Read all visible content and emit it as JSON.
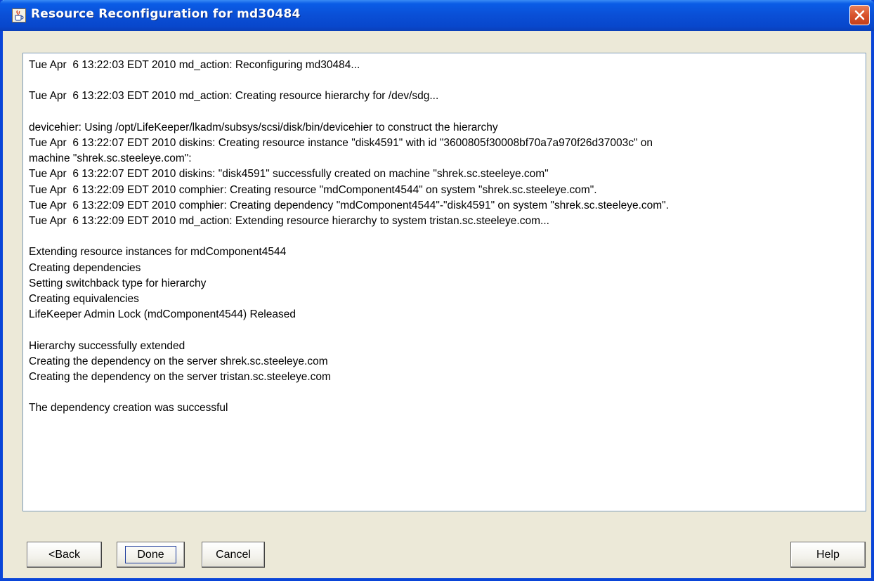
{
  "window": {
    "title": "Resource Reconfiguration for md30484",
    "title_icon": "java-cup-icon",
    "close_icon": "close-icon"
  },
  "log": {
    "lines": [
      "Tue Apr  6 13:22:03 EDT 2010 md_action: Reconfiguring md30484...",
      "",
      "Tue Apr  6 13:22:03 EDT 2010 md_action: Creating resource hierarchy for /dev/sdg...",
      "",
      "devicehier: Using /opt/LifeKeeper/lkadm/subsys/scsi/disk/bin/devicehier to construct the hierarchy",
      "Tue Apr  6 13:22:07 EDT 2010 diskins: Creating resource instance \"disk4591\" with id \"3600805f30008bf70a7a970f26d37003c\" on",
      "machine \"shrek.sc.steeleye.com\":",
      "Tue Apr  6 13:22:07 EDT 2010 diskins: \"disk4591\" successfully created on machine \"shrek.sc.steeleye.com\"",
      "Tue Apr  6 13:22:09 EDT 2010 comphier: Creating resource \"mdComponent4544\" on system \"shrek.sc.steeleye.com\".",
      "Tue Apr  6 13:22:09 EDT 2010 comphier: Creating dependency \"mdComponent4544\"-\"disk4591\" on system \"shrek.sc.steeleye.com\".",
      "Tue Apr  6 13:22:09 EDT 2010 md_action: Extending resource hierarchy to system tristan.sc.steeleye.com...",
      "",
      "Extending resource instances for mdComponent4544",
      "Creating dependencies",
      "Setting switchback type for hierarchy",
      "Creating equivalencies",
      "LifeKeeper Admin Lock (mdComponent4544) Released",
      "",
      "Hierarchy successfully extended",
      "Creating the dependency on the server shrek.sc.steeleye.com",
      "Creating the dependency on the server tristan.sc.steeleye.com",
      "",
      "The dependency creation was successful"
    ]
  },
  "buttons": {
    "back_label": "<Back",
    "done_label": "Done",
    "cancel_label": "Cancel",
    "help_label": "Help"
  },
  "colors": {
    "titlebar": "#0a4fd6",
    "close_button": "#d9532c",
    "window_bg": "#ece9d8",
    "log_border": "#7f9db9"
  }
}
